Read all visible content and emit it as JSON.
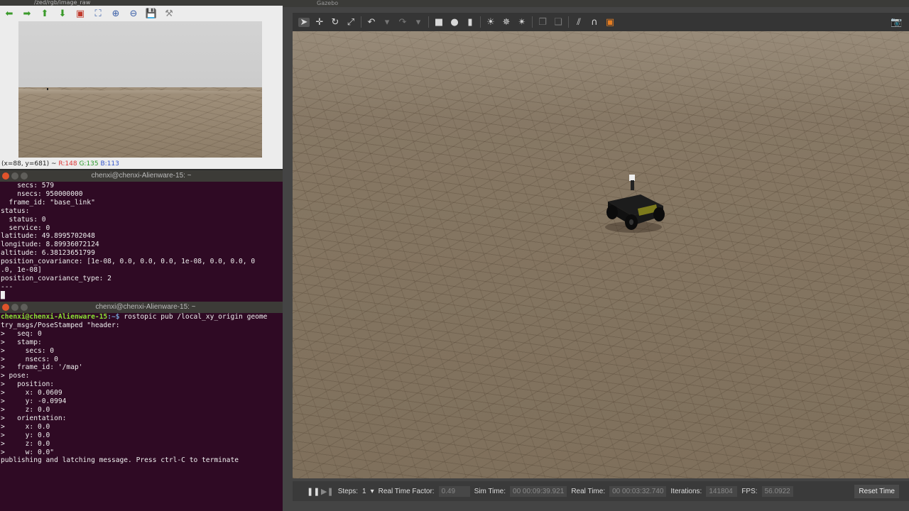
{
  "imageview": {
    "title": "/zed/rgb/image_raw",
    "status_coords": "(x=88, y=681) ~ ",
    "status_r": "R:148",
    "status_g": "G:135",
    "status_b": "B:113",
    "toolbar_icons": [
      "back-arrow-icon",
      "forward-arrow-icon",
      "up-arrow-icon",
      "down-arrow-icon",
      "save-image-icon",
      "fit-icon",
      "zoom-in-icon",
      "zoom-out-icon",
      "save-icon",
      "settings-icon"
    ]
  },
  "term1": {
    "title": "chenxi@chenxi-Alienware-15: ~",
    "lines": [
      "    secs: 579",
      "    nsecs: 950000000",
      "  frame_id: \"base_link\"",
      "status:",
      "  status: 0",
      "  service: 0",
      "latitude: 49.8995702048",
      "longitude: 8.89936072124",
      "altitude: 6.38123651799",
      "position_covariance: [1e-08, 0.0, 0.0, 0.0, 1e-08, 0.0, 0.0, 0",
      ".0, 1e-08]",
      "position_covariance_type: 2",
      "---",
      "█"
    ]
  },
  "term2": {
    "title": "chenxi@chenxi-Alienware-15: ~",
    "prompt_user": "chenxi@chenxi-Alienware-15",
    "prompt_path": ":~$",
    "command": " rostopic pub /local_xy_origin geome",
    "lines": [
      "try_msgs/PoseStamped \"header:",
      ">   seq: 0",
      ">   stamp:",
      ">     secs: 0",
      ">     nsecs: 0",
      ">   frame_id: '/map'",
      "> pose:",
      ">   position:",
      ">     x: 0.0609",
      ">     y: -0.0994",
      ">     z: 0.0",
      ">   orientation:",
      ">     x: 0.0",
      ">     y: 0.0",
      ">     z: 0.0",
      ">     w: 0.0\"",
      "publishing and latching message. Press ctrl-C to terminate"
    ]
  },
  "gazebo": {
    "title": "Gazebo",
    "steps_label": "Steps:",
    "steps_value": "1",
    "rtf_label": "Real Time Factor:",
    "rtf_value": "0.49",
    "simtime_label": "Sim Time:",
    "simtime_value": "00 00:09:39.921",
    "realtime_label": "Real Time:",
    "realtime_value": "00 00:03:32.740",
    "iterations_label": "Iterations:",
    "iterations_value": "141804",
    "fps_label": "FPS:",
    "fps_value": "56.0922",
    "reset_label": "Reset Time"
  }
}
